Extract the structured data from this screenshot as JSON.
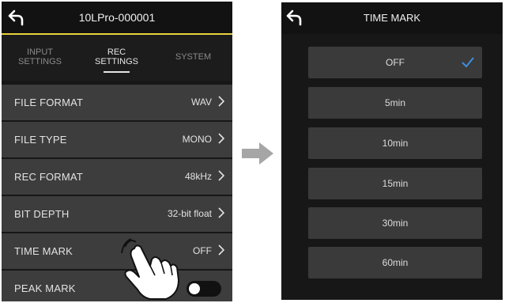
{
  "left": {
    "title": "10LPro-000001",
    "tabs": [
      {
        "line1": "INPUT",
        "line2": "SETTINGS"
      },
      {
        "line1": "REC",
        "line2": "SETTINGS"
      },
      {
        "line1": "SYSTEM",
        "line2": ""
      }
    ],
    "rows": [
      {
        "label": "FILE FORMAT",
        "value": "WAV"
      },
      {
        "label": "FILE TYPE",
        "value": "MONO"
      },
      {
        "label": "REC FORMAT",
        "value": "48kHz"
      },
      {
        "label": "BIT DEPTH",
        "value": "32-bit float"
      },
      {
        "label": "TIME MARK",
        "value": "OFF"
      },
      {
        "label": "PEAK MARK",
        "value": ""
      }
    ]
  },
  "right": {
    "title": "TIME MARK",
    "options": [
      "OFF",
      "5min",
      "10min",
      "15min",
      "30min",
      "60min"
    ],
    "selected": "OFF"
  },
  "colors": {
    "accent": "#e8d23e",
    "check": "#3d8fe0",
    "row": "#3d3d3d",
    "screen": "#171717"
  }
}
